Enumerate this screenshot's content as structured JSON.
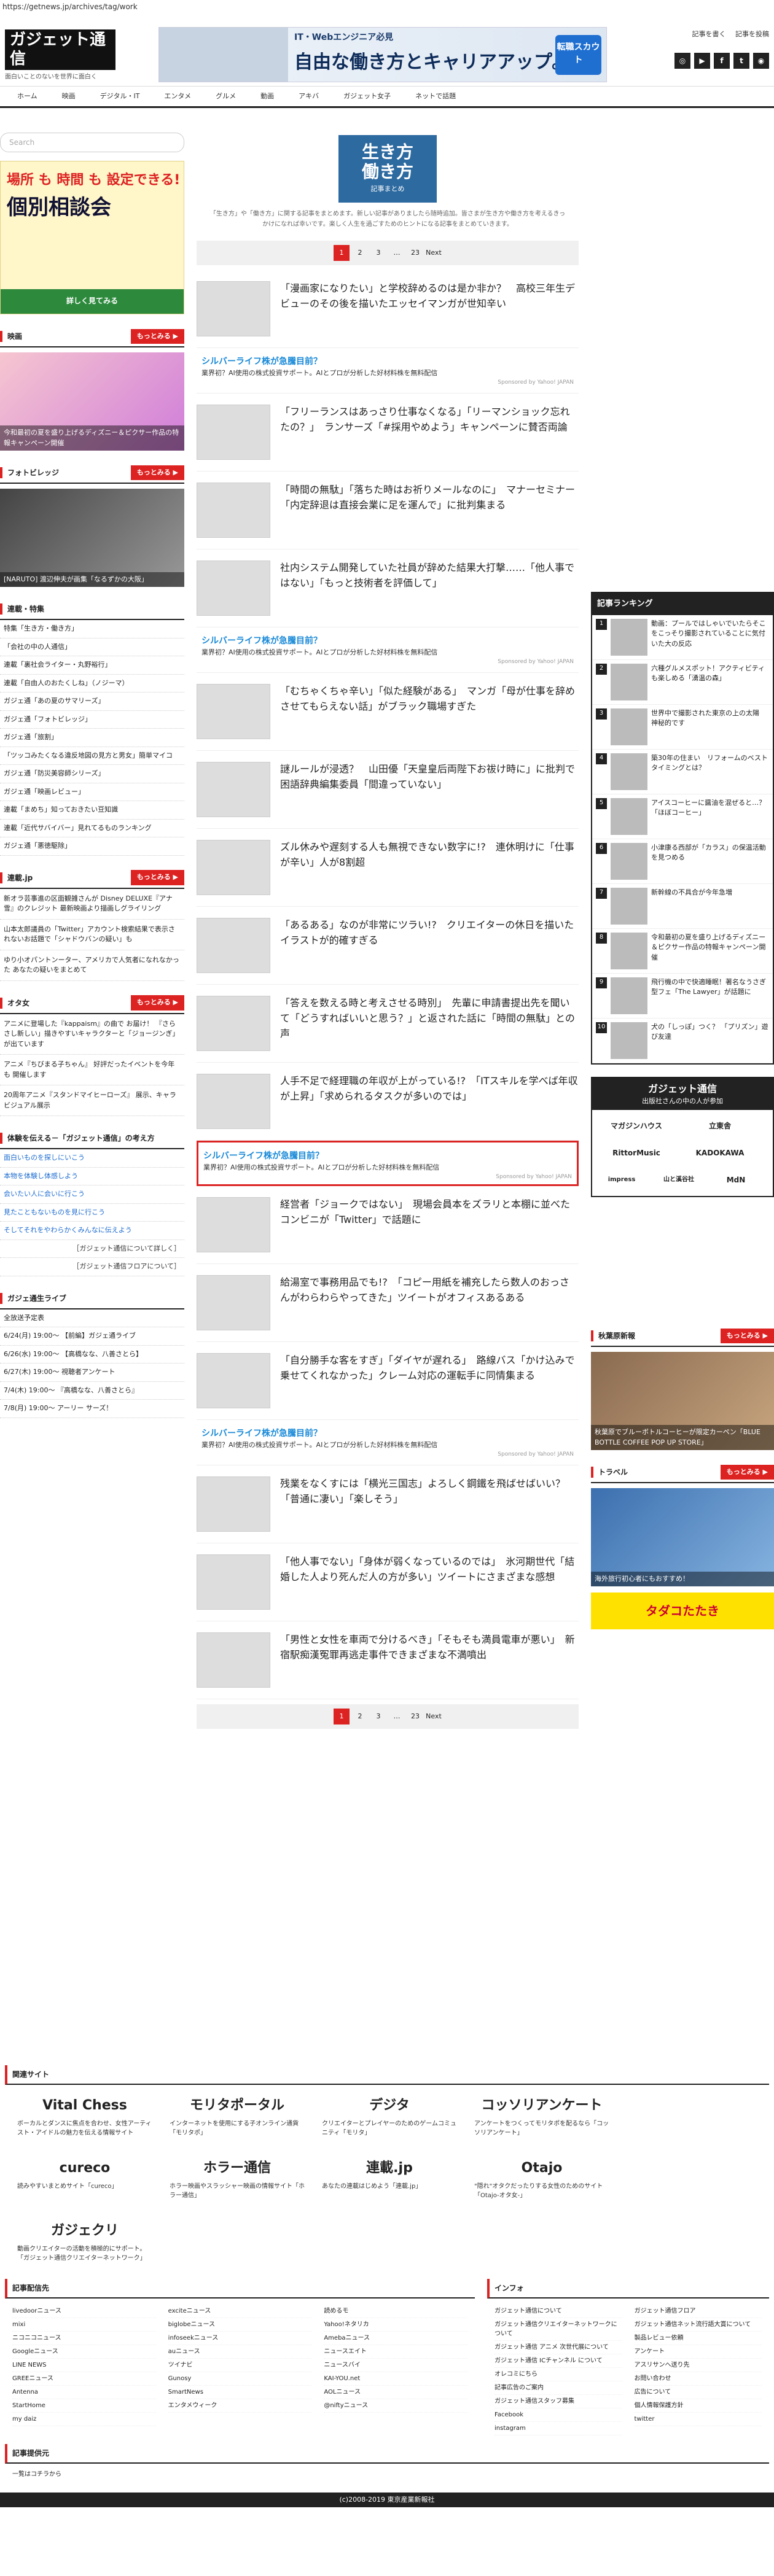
{
  "url": "https://getnews.jp/archives/tag/work",
  "brand": {
    "logo": "ガジェット通信",
    "tagline": "面白いことのないを世界に面白く"
  },
  "header": {
    "banner_line1": "IT・Webエンジニア必見",
    "banner_line2": "自由な働き方とキャリアアップ。",
    "banner_btn": "転職スカウト",
    "link1": "記事を書く",
    "link2": "記事を投稿"
  },
  "social_icons": [
    "instagram-icon",
    "youtube-icon",
    "facebook-icon",
    "twitter-icon",
    "rss-icon"
  ],
  "nav": [
    "ホーム",
    "映画",
    "デジタル・IT",
    "エンタメ",
    "グルメ",
    "動画",
    "アキバ",
    "ガジェット女子",
    "ネットで話題"
  ],
  "search": {
    "placeholder": "Search"
  },
  "left": {
    "ad_line1": "場所 も 時間 も 設定できる!",
    "ad_line2": "個別相談会",
    "ad_strip": "詳しく見てみる",
    "sec_eiga": "映画",
    "eiga_cap": "今和最初の夏を盛り上げるディズニー＆ピクサー作品の特報キャンペーン開催",
    "sec_photo": "フォトビレッジ",
    "photo_cap": "[NARUTO] 渡辺伸夫が画集「なるずかの大阪」",
    "sec_rensai": "連載・特集",
    "rensai": [
      "特集「生き方・働き方」",
      "「会社の中の人通信」",
      "連載「裏社会ライター・丸野裕行」",
      "連載「自由人のおたくしね」（ノジーマ）",
      "ガジェ通「あの夏のサマリーズ」",
      "ガジェ通「フォトビレッジ」",
      "ガジェ通「旅割」",
      "「ツッコみたくなる違反地図の見方と男女」簡単マイコ",
      "ガジェ通「防災美容師シリーズ」",
      "ガジェ通「映画レビュー」",
      "連載「まめち」知っておきたい豆知識",
      "連載「近代サバイバー」見れてるものランキング",
      "ガジェ通「悪徳駆除」"
    ],
    "sec_rensaijp": "連載.jp",
    "rensaijp": [
      "新オラ芸事進の区面観雑さんが Disney DELUXE『アナ雪』のクレジット 最新映画より描画しグライリング",
      "山本太郎議員の「Twitter」アカウント検索結果で表示されないお話題で「シャドウバンの疑い」も",
      "ゆり小オパントンーター、アメリカで人気者になれなかった あなたの疑いをまとめて"
    ],
    "sec_otaku": "オタ女",
    "otaku": [
      "アニメに登場した『kappaism』の曲で お届け！ 『さらさし新しい」描きやすいキャラクターと「ジョージンぎ」が出ています",
      "アニメ『ちびまる子ちゃん』 好評だったイベントを今年も 開催します",
      "20周年アニメ『スタンドマイヒーローズ』 展示、キャラビジュアル展示"
    ],
    "sec_taiken": "体験を伝える－「ガジェット通信」の考え方",
    "taiken": [
      "面白いものを探しにいこう",
      "本物を体験し体感しよう",
      "会いたい人に会いに行こう",
      "見たこともないものを見に行こう",
      "そしてそれをやわらかくみんなに伝えよう"
    ],
    "taiken_sub": [
      "［ガジェット通信について詳しく］",
      "［ガジェット通信フロアについて］"
    ],
    "sec_live": "ガジェ通生ライブ",
    "live": [
      "全放送予定表",
      "6/24(月) 19:00〜 【前編】ガジェ通ライブ",
      "6/26(水) 19:00〜 【高橋なな、八善さとら】",
      "6/27(木) 19:00〜 視聴者アンケート",
      "7/4(木) 19:00〜 『高橋なな、八善さとら』",
      "7/8(月) 19:00〜 アーリー サーズ！"
    ]
  },
  "center": {
    "tag_title_1": "生き方",
    "tag_title_2": "働き方",
    "tag_sub": "記事まとめ",
    "tag_desc": "「生き方」や「働き方」に関する記事をまとめます。新しい記事がありましたら随時追加。皆さまが生き方や働き方を考えるきっかけになれば幸いです。楽しく人生を過ごすためのヒントになる記事をまとめていきます。",
    "pager": [
      "1",
      "2",
      "3",
      "…",
      "23",
      "Next"
    ],
    "articles": [
      "「漫画家になりたい」と学校辞めるのは是か非か？　高校三年生デビューのその後を描いたエッセイマンガが世知辛い",
      "PR",
      "「フリーランスはあっさり仕事なくなる」「リーマンショック忘れたの？」　ランサーズ「#採用やめよう」キャンペーンに賛否両論",
      "「時間の無駄」「落ちた時はお祈りメールなのに」　マナーセミナー「内定辞退は直接会業に足を運んで」に批判集まる",
      "社内システム開発していた社員が辞めた結果大打撃……「他人事ではない」「もっと技術者を評価して」",
      "PR",
      "「むちゃくちゃ辛い」「似た経験がある」　マンガ「母が仕事を辞めさせてもらえない話」がブラック職場すぎた",
      "謎ルールが浸透？　山田優「天皇皇后両陛下お祓け時に」に批判で困語辞典編集委員「間違っていない」",
      "ズル休みや遅刻する人も無視できない数字に!?　連休明けに「仕事が辛い」人が8割超",
      "「あるある」なのが非常にツラい!?　クリエイターの休日を描いたイラストが的確すぎる",
      "「答えを数える時と考えさせる時別」　先輩に申請書提出先を聞いて「どうすればいいと思う？」と返された話に「時間の無駄」との声",
      "人手不足で経理職の年収が上がっている!?　「ITスキルを学べば年収が上昇」「求められるタスクが多いのでは」",
      "PR",
      "経営者「ジョークではない」　現場会員本をズラリと本棚に並べたコンビニが「Twitter」で話題に",
      "給湯室で事務用品でも!?　「コピー用紙を補充したら数人のおっさんがわらわらやってきた」ツイートがオフィスあるある",
      "「自分勝手な客をすぎ」「ダイヤが遅れる」　路線バス「かけ込みで乗せてくれなかった」クレーム対応の運転手に同情集まる",
      "PR",
      "残業をなくすには「横光三国志」よろしく鋼鐵を飛ばせばいい？　「普通に凄い」「楽しそう」",
      "「他人事でない」「身体が弱くなっているのでは」　氷河期世代「結婚した人より死んだ人の方が多い」ツイートにさまざまな感想",
      "「男性と女性を車両で分けるべき」「そもそも満員電車が悪い」　新宿駅痴漢冤罪再逃走事件できまざまな不満噴出"
    ],
    "pr_title": "シルバーライフ株が急騰目前？",
    "pr_desc": "業界初？AI使用の株式投資サポート。AIとプロが分析した好材料株を無料配信",
    "pr_by": "Sponsored by Yahoo! JAPAN"
  },
  "right": {
    "rank_title": "記事ランキング",
    "rank": [
      "動画：プールではしゃいでいたらそこをこっそり撮影されていることに気付いた大の反応",
      "六種グルメスポット！アクティビティも楽しめる「湧温の森」",
      "世界中で撮影された東京の上の太陽　神秘的です",
      "築30年の住まい　リフォームのベストタイミングとは？",
      "アイスコーヒーに醤油を混ぜると…？ 「ほぼコーヒー」",
      "小津康る西部が「カラス」の保温活動を見つめる",
      "新幹線の不具合が今年急増",
      "令和最初の夏を盛り上げるディズニー＆ピクサー作品の特報キャンペーン開催",
      "飛行機の中で快適睡眠！著名なうさぎ型フェ「The Lawyer」が話題に",
      "犬の「しっぽ」つく？ 「プリズン」遊び友達"
    ],
    "company_title": "ガジェット通信",
    "company_sub": "出版社さんの中の人が参加",
    "companies": [
      "マガジンハウス",
      "立東舎",
      "RittorMusic",
      "KADOKAWA",
      "impress",
      "山と溪谷社",
      "MdN"
    ],
    "sec_jisha": "秋葉原新報",
    "jisha_cap": "秋葉原でブルーボトルコーヒーが限定カーペン「BLUE BOTTLE COFFEE POP UP STORE」",
    "sec_travel": "トラベル",
    "travel_cap": "海外旅行初心者にもおすすめ！",
    "travel_ad": "タダコたたき"
  },
  "footer": {
    "related_title": "関連サイト",
    "sites": [
      {
        "logo": "Vital Chess",
        "desc": "ボーカルとダンスに焦点を合わせ、女性アーティスト・アイドルの魅力を伝える情報サイト"
      },
      {
        "logo": "モリタポータル",
        "desc": "インターネットを使用にする子オンライン通貨「モリタポ」"
      },
      {
        "logo": "デジタ",
        "desc": "クリエイターとプレイヤーのためのゲームコミュニティ「モリタ」"
      },
      {
        "logo": "コッソリアンケート",
        "desc": "アンケートをつくってモリタポを配るなら「コッソリアンケート」"
      },
      {
        "logo": "cureco",
        "desc": "読みやすいまとめサイト「cureco」"
      },
      {
        "logo": "ホラー通信",
        "desc": "ホラー映画やスラッシャー映画の情報サイト「ホラー通信」"
      },
      {
        "logo": "連載.jp",
        "desc": "あなたの連載はじめよう「連載.jp」"
      },
      {
        "logo": "Otajo",
        "desc": "\"隠れ\"オタクだったりする女性のためのサイト「Otajo-オタ女-」"
      },
      {
        "logo": "ガジェクリ",
        "desc": "動画クリエイターの活動を積極的にサポート。「ガジェット通信クリエイターネットワーク」"
      }
    ],
    "dist_title": "記事配信先",
    "dist": [
      [
        "livedoorニュース",
        "mixi",
        "ニコニコニュース",
        "Googleニュース",
        "LINE NEWS",
        "GREEニュース",
        "Antenna",
        "StartHome",
        "my daiz"
      ],
      [
        "exciteニュース",
        "biglobeニュース",
        "infoseekニュース",
        "auニュース",
        "ツイナビ",
        "Gunosy",
        "SmartNews",
        "エンタメウィーク"
      ],
      [
        "読めるモ",
        "Yahoo!ネタリカ",
        "Amebaニュース",
        "ニュースエイト",
        "ニュースバイ",
        "KAI-YOU.net",
        "AOLニュース",
        "@niftyニュース"
      ]
    ],
    "info_title": "インフォ",
    "info": [
      [
        "ガジェット通信について",
        "ガジェット通信クリエイターネットワークについて",
        "ガジェット通信 アニメ 次世代展について",
        "ガジェット通信 ICチャンネル について",
        "オレコミにちら",
        "記事広告のご案内",
        "ガジェット通信スタッフ募集",
        "Facebook",
        "instagram"
      ],
      [
        "ガジェット通信フロア",
        "ガジェット通信ネット流行語大賞について",
        "製品レビュー依頼",
        "アンケート",
        "アスリサンへ送り先",
        "お問い合わせ",
        "広告について",
        "個人情報保護方針",
        "twitter"
      ]
    ],
    "cohost_title": "記事提供元",
    "cohost": "一覧はコチラから",
    "copyright": "(c)2008-2019 東京産業新報社"
  }
}
